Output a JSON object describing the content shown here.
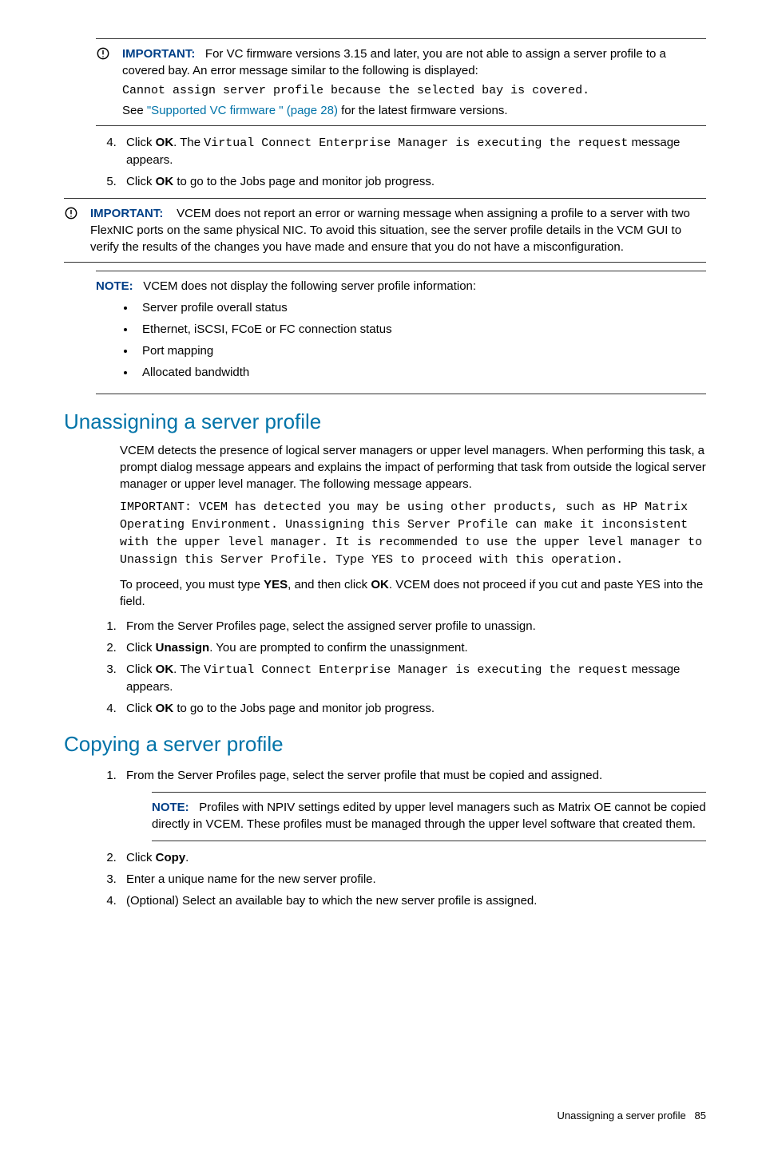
{
  "imp1": {
    "label": "IMPORTANT:",
    "line1a": "For VC firmware versions 3.15 and later, you are not able to assign a server profile to a covered bay. An error message similar to the following is displayed:",
    "code": "Cannot assign server profile because the selected bay is covered.",
    "see": "See ",
    "link": "\"Supported VC firmware \" (page 28)",
    "after_link": " for the latest firmware versions."
  },
  "steps_a": {
    "s4_a": "Click ",
    "s4_ok": "OK",
    "s4_b": ". The ",
    "s4_code": "Virtual Connect Enterprise Manager is executing the request",
    "s4_c": " message appears.",
    "s5_a": "Click ",
    "s5_ok": "OK",
    "s5_b": " to go to the Jobs page and monitor job progress."
  },
  "imp2": {
    "label": "IMPORTANT:",
    "text": "VCEM does not report an error or warning message when assigning a profile to a server with two FlexNIC ports on the same physical NIC. To avoid this situation, see the server profile details in the VCM GUI to verify the results of the changes you have made and ensure that you do not have a misconfiguration."
  },
  "note1": {
    "label": "NOTE:",
    "lead": "VCEM does not display the following server profile information:",
    "b1": "Server profile overall status",
    "b2": "Ethernet, iSCSI, FCoE or FC connection status",
    "b3": "Port mapping",
    "b4": "Allocated bandwidth"
  },
  "sec1": {
    "title": "Unassigning a server profile",
    "p1": "VCEM detects the presence of logical server managers or upper level managers. When performing this task, a prompt dialog message appears and explains the impact of performing that task from outside the logical server manager or upper level manager. The following message appears.",
    "code": "IMPORTANT: VCEM has detected you may be using other products, such as HP Matrix Operating Environment. Unassigning this Server Profile can make it inconsistent with the upper level manager. It is recommended to use the upper level manager to Unassign this Server Profile. Type YES to proceed with this operation.",
    "p2a": "To proceed, you must type ",
    "p2yes": "YES",
    "p2b": ", and then click ",
    "p2ok": "OK",
    "p2c": ". VCEM does not proceed if you cut and paste YES into the field.",
    "s1": "From the Server Profiles page, select the assigned server profile to unassign.",
    "s2a": "Click ",
    "s2b": "Unassign",
    "s2c": ". You are prompted to confirm the unassignment.",
    "s3a": "Click ",
    "s3ok": "OK",
    "s3b": ". The ",
    "s3code": "Virtual Connect Enterprise Manager is executing the request",
    "s3c": " message appears.",
    "s4a": "Click ",
    "s4ok": "OK",
    "s4b": " to go to the Jobs page and monitor job progress."
  },
  "sec2": {
    "title": "Copying a server profile",
    "s1": "From the Server Profiles page, select the server profile that must be copied and assigned.",
    "note_label": "NOTE:",
    "note_text": "Profiles with NPIV settings edited by upper level managers such as Matrix OE cannot be copied directly in VCEM. These profiles must be managed through the upper level software that created them.",
    "s2a": "Click ",
    "s2b": "Copy",
    "s2c": ".",
    "s3": "Enter a unique name for the new server profile.",
    "s4": "(Optional) Select an available bay to which the new server profile is assigned."
  },
  "footer": {
    "text": "Unassigning a server profile",
    "page": "85"
  }
}
